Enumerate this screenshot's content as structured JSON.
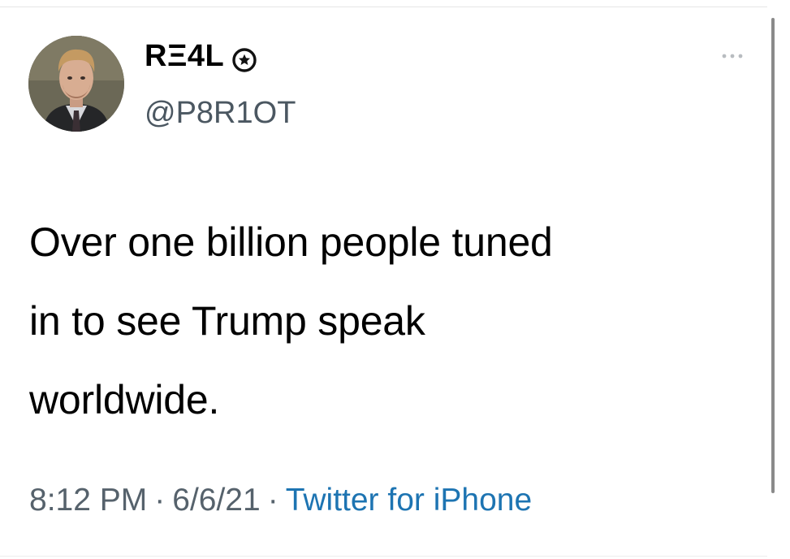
{
  "tweet": {
    "author": {
      "display_name": "RΞ4L",
      "handle": "@P8R1OT",
      "badge_icon": "star-badge-icon",
      "avatar": "profile-photo"
    },
    "more_icon": "more-options-icon",
    "text": "Over one billion people tuned\nin to see Trump speak\nworldwide.",
    "time": "8:12 PM",
    "date": "6/6/21",
    "separator": "·",
    "source": "Twitter for iPhone"
  },
  "colors": {
    "text": "#000000",
    "secondary_text": "#56626c",
    "link": "#1d74b2",
    "background": "#ffffff"
  }
}
